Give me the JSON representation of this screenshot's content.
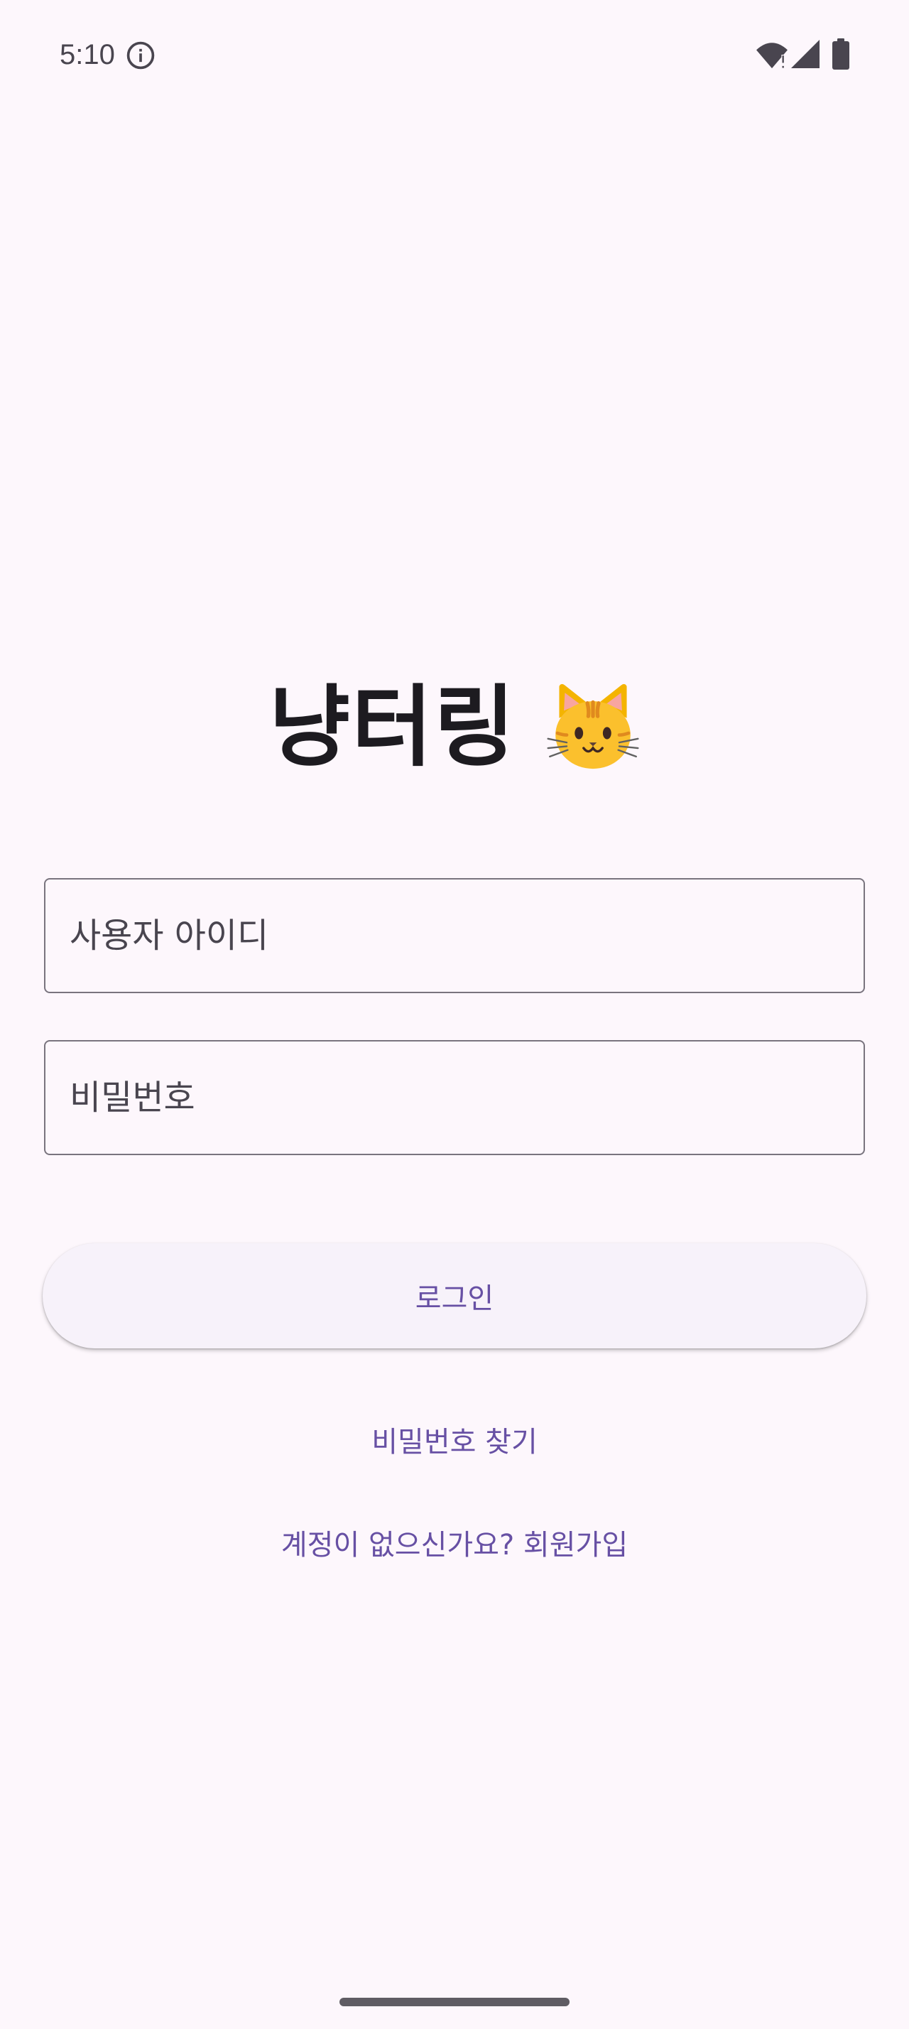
{
  "status_bar": {
    "time": "5:10",
    "icons": [
      "info-icon",
      "wifi-icon",
      "signal-icon",
      "battery-icon"
    ]
  },
  "app": {
    "title": "냥터링",
    "title_icon": "cat-face-icon"
  },
  "form": {
    "username_placeholder": "사용자 아이디",
    "password_placeholder": "비밀번호",
    "login_label": "로그인"
  },
  "links": {
    "find_password": "비밀번호 찾기",
    "signup": "계정이 없으신가요? 회원가입"
  },
  "colors": {
    "background": "#fdf7fc",
    "primary": "#6750a4",
    "outline": "#79747e",
    "on_surface": "#1d1b20",
    "on_surface_variant": "#49454f",
    "button_surface": "#f7f2fa"
  }
}
